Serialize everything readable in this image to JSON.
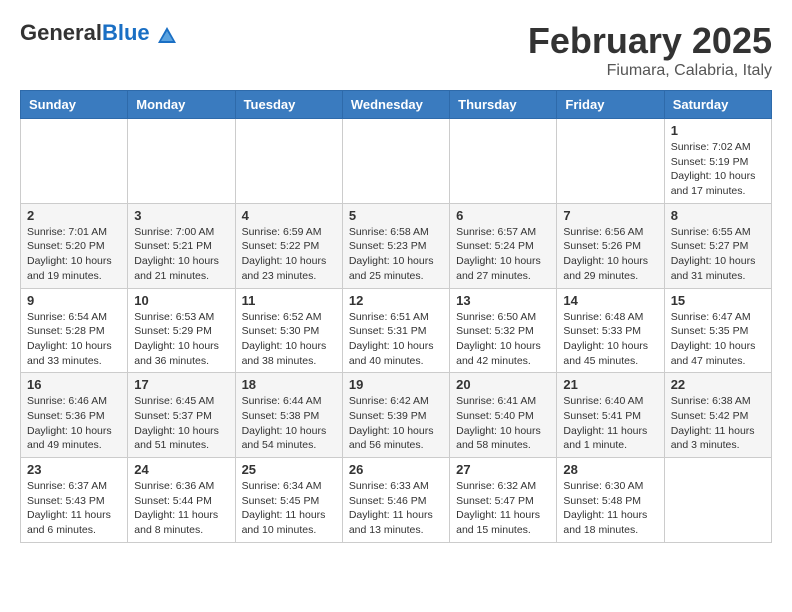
{
  "logo": {
    "general": "General",
    "blue": "Blue"
  },
  "header": {
    "month": "February 2025",
    "location": "Fiumara, Calabria, Italy"
  },
  "days_of_week": [
    "Sunday",
    "Monday",
    "Tuesday",
    "Wednesday",
    "Thursday",
    "Friday",
    "Saturday"
  ],
  "weeks": [
    [
      {
        "num": "",
        "info": ""
      },
      {
        "num": "",
        "info": ""
      },
      {
        "num": "",
        "info": ""
      },
      {
        "num": "",
        "info": ""
      },
      {
        "num": "",
        "info": ""
      },
      {
        "num": "",
        "info": ""
      },
      {
        "num": "1",
        "info": "Sunrise: 7:02 AM\nSunset: 5:19 PM\nDaylight: 10 hours\nand 17 minutes."
      }
    ],
    [
      {
        "num": "2",
        "info": "Sunrise: 7:01 AM\nSunset: 5:20 PM\nDaylight: 10 hours\nand 19 minutes."
      },
      {
        "num": "3",
        "info": "Sunrise: 7:00 AM\nSunset: 5:21 PM\nDaylight: 10 hours\nand 21 minutes."
      },
      {
        "num": "4",
        "info": "Sunrise: 6:59 AM\nSunset: 5:22 PM\nDaylight: 10 hours\nand 23 minutes."
      },
      {
        "num": "5",
        "info": "Sunrise: 6:58 AM\nSunset: 5:23 PM\nDaylight: 10 hours\nand 25 minutes."
      },
      {
        "num": "6",
        "info": "Sunrise: 6:57 AM\nSunset: 5:24 PM\nDaylight: 10 hours\nand 27 minutes."
      },
      {
        "num": "7",
        "info": "Sunrise: 6:56 AM\nSunset: 5:26 PM\nDaylight: 10 hours\nand 29 minutes."
      },
      {
        "num": "8",
        "info": "Sunrise: 6:55 AM\nSunset: 5:27 PM\nDaylight: 10 hours\nand 31 minutes."
      }
    ],
    [
      {
        "num": "9",
        "info": "Sunrise: 6:54 AM\nSunset: 5:28 PM\nDaylight: 10 hours\nand 33 minutes."
      },
      {
        "num": "10",
        "info": "Sunrise: 6:53 AM\nSunset: 5:29 PM\nDaylight: 10 hours\nand 36 minutes."
      },
      {
        "num": "11",
        "info": "Sunrise: 6:52 AM\nSunset: 5:30 PM\nDaylight: 10 hours\nand 38 minutes."
      },
      {
        "num": "12",
        "info": "Sunrise: 6:51 AM\nSunset: 5:31 PM\nDaylight: 10 hours\nand 40 minutes."
      },
      {
        "num": "13",
        "info": "Sunrise: 6:50 AM\nSunset: 5:32 PM\nDaylight: 10 hours\nand 42 minutes."
      },
      {
        "num": "14",
        "info": "Sunrise: 6:48 AM\nSunset: 5:33 PM\nDaylight: 10 hours\nand 45 minutes."
      },
      {
        "num": "15",
        "info": "Sunrise: 6:47 AM\nSunset: 5:35 PM\nDaylight: 10 hours\nand 47 minutes."
      }
    ],
    [
      {
        "num": "16",
        "info": "Sunrise: 6:46 AM\nSunset: 5:36 PM\nDaylight: 10 hours\nand 49 minutes."
      },
      {
        "num": "17",
        "info": "Sunrise: 6:45 AM\nSunset: 5:37 PM\nDaylight: 10 hours\nand 51 minutes."
      },
      {
        "num": "18",
        "info": "Sunrise: 6:44 AM\nSunset: 5:38 PM\nDaylight: 10 hours\nand 54 minutes."
      },
      {
        "num": "19",
        "info": "Sunrise: 6:42 AM\nSunset: 5:39 PM\nDaylight: 10 hours\nand 56 minutes."
      },
      {
        "num": "20",
        "info": "Sunrise: 6:41 AM\nSunset: 5:40 PM\nDaylight: 10 hours\nand 58 minutes."
      },
      {
        "num": "21",
        "info": "Sunrise: 6:40 AM\nSunset: 5:41 PM\nDaylight: 11 hours\nand 1 minute."
      },
      {
        "num": "22",
        "info": "Sunrise: 6:38 AM\nSunset: 5:42 PM\nDaylight: 11 hours\nand 3 minutes."
      }
    ],
    [
      {
        "num": "23",
        "info": "Sunrise: 6:37 AM\nSunset: 5:43 PM\nDaylight: 11 hours\nand 6 minutes."
      },
      {
        "num": "24",
        "info": "Sunrise: 6:36 AM\nSunset: 5:44 PM\nDaylight: 11 hours\nand 8 minutes."
      },
      {
        "num": "25",
        "info": "Sunrise: 6:34 AM\nSunset: 5:45 PM\nDaylight: 11 hours\nand 10 minutes."
      },
      {
        "num": "26",
        "info": "Sunrise: 6:33 AM\nSunset: 5:46 PM\nDaylight: 11 hours\nand 13 minutes."
      },
      {
        "num": "27",
        "info": "Sunrise: 6:32 AM\nSunset: 5:47 PM\nDaylight: 11 hours\nand 15 minutes."
      },
      {
        "num": "28",
        "info": "Sunrise: 6:30 AM\nSunset: 5:48 PM\nDaylight: 11 hours\nand 18 minutes."
      },
      {
        "num": "",
        "info": ""
      }
    ]
  ]
}
